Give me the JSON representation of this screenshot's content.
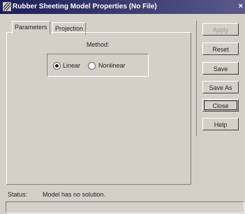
{
  "window": {
    "title": "Rubber Sheeting Model Properties (No File)",
    "close_glyph": "×"
  },
  "tabs": [
    {
      "label": "Parameters"
    },
    {
      "label": "Projection"
    }
  ],
  "method": {
    "label": "Method:",
    "options": [
      {
        "label": "Linear",
        "selected": true
      },
      {
        "label": "Nonlinear",
        "selected": false
      }
    ]
  },
  "buttons": {
    "apply": "Apply",
    "reset": "Reset",
    "save": "Save",
    "save_as": "Save As",
    "close": "Close",
    "help": "Help"
  },
  "status": {
    "label": "Status:",
    "text": "Model has no solution."
  }
}
